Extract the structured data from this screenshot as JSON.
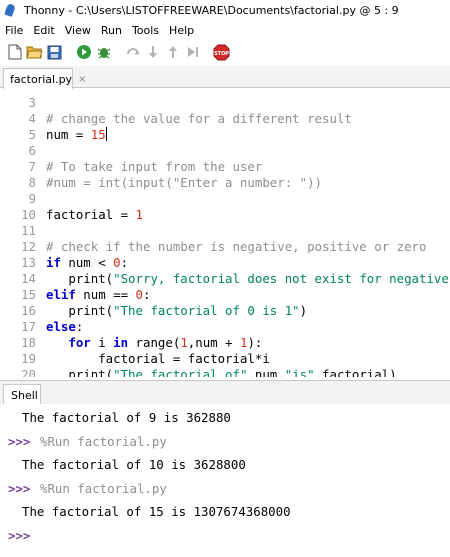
{
  "window": {
    "title": "Thonny  -  C:\\Users\\LISTOFFREEWARE\\Documents\\factorial.py  @  5 : 9"
  },
  "menu": [
    "File",
    "Edit",
    "View",
    "Run",
    "Tools",
    "Help"
  ],
  "toolbar": {
    "buttons": [
      "new-file-icon",
      "open-file-icon",
      "save-file-icon",
      "run-icon",
      "debug-icon",
      "step-over-icon",
      "step-into-icon",
      "step-out-icon",
      "resume-icon",
      "stop-icon"
    ],
    "stop_label": "STOP"
  },
  "editor": {
    "tab_label": "factorial.py",
    "tab_close": "×",
    "lines": [
      {
        "n": "3",
        "segs": []
      },
      {
        "n": "4",
        "segs": [
          {
            "c": "cmt",
            "t": "# change the value for a different result"
          }
        ]
      },
      {
        "n": "5",
        "segs": [
          {
            "c": "",
            "t": "num = "
          },
          {
            "c": "num",
            "t": "15"
          }
        ],
        "caret": true
      },
      {
        "n": "6",
        "segs": []
      },
      {
        "n": "7",
        "segs": [
          {
            "c": "cmt",
            "t": "# To take input from the user"
          }
        ]
      },
      {
        "n": "8",
        "segs": [
          {
            "c": "cmt",
            "t": "#num = int(input(\"Enter a number: \"))"
          }
        ]
      },
      {
        "n": "9",
        "segs": []
      },
      {
        "n": "10",
        "segs": [
          {
            "c": "",
            "t": "factorial = "
          },
          {
            "c": "num",
            "t": "1"
          }
        ]
      },
      {
        "n": "11",
        "segs": []
      },
      {
        "n": "12",
        "segs": [
          {
            "c": "cmt",
            "t": "# check if the number is negative, positive or zero"
          }
        ]
      },
      {
        "n": "13",
        "segs": [
          {
            "c": "kw",
            "t": "if"
          },
          {
            "c": "",
            "t": " num < "
          },
          {
            "c": "num",
            "t": "0"
          },
          {
            "c": "",
            "t": ":"
          }
        ]
      },
      {
        "n": "14",
        "segs": [
          {
            "c": "",
            "t": "   print("
          },
          {
            "c": "str",
            "t": "\"Sorry, factorial does not exist for negative nu"
          }
        ]
      },
      {
        "n": "15",
        "segs": [
          {
            "c": "kw",
            "t": "elif"
          },
          {
            "c": "",
            "t": " num == "
          },
          {
            "c": "num",
            "t": "0"
          },
          {
            "c": "",
            "t": ":"
          }
        ]
      },
      {
        "n": "16",
        "segs": [
          {
            "c": "",
            "t": "   print("
          },
          {
            "c": "str",
            "t": "\"The factorial of 0 is 1\""
          },
          {
            "c": "",
            "t": ")"
          }
        ]
      },
      {
        "n": "17",
        "segs": [
          {
            "c": "kw",
            "t": "else"
          },
          {
            "c": "",
            "t": ":"
          }
        ]
      },
      {
        "n": "18",
        "segs": [
          {
            "c": "",
            "t": "   "
          },
          {
            "c": "kw",
            "t": "for"
          },
          {
            "c": "",
            "t": " i "
          },
          {
            "c": "kw",
            "t": "in"
          },
          {
            "c": "",
            "t": " range("
          },
          {
            "c": "num",
            "t": "1"
          },
          {
            "c": "",
            "t": ",num + "
          },
          {
            "c": "num",
            "t": "1"
          },
          {
            "c": "",
            "t": "):"
          }
        ]
      },
      {
        "n": "19",
        "segs": [
          {
            "c": "",
            "t": "       factorial = factorial*i"
          }
        ]
      },
      {
        "n": "20",
        "segs": [
          {
            "c": "",
            "t": "   print("
          },
          {
            "c": "str",
            "t": "\"The factorial of\""
          },
          {
            "c": "",
            "t": ",num,"
          },
          {
            "c": "str",
            "t": "\"is\""
          },
          {
            "c": "",
            "t": ",factorial)"
          }
        ]
      }
    ]
  },
  "shell": {
    "tab_label": "Shell",
    "lines": [
      {
        "type": "out",
        "text": "The factorial of 9 is 362880"
      },
      {
        "type": "cmd",
        "prompt": ">>>",
        "text": "%Run factorial.py"
      },
      {
        "type": "out",
        "text": "The factorial of 10 is 3628800"
      },
      {
        "type": "cmd",
        "prompt": ">>>",
        "text": "%Run factorial.py"
      },
      {
        "type": "out",
        "text": "The factorial of 15 is 1307674368000"
      },
      {
        "type": "cmd",
        "prompt": ">>>",
        "text": ""
      }
    ]
  }
}
